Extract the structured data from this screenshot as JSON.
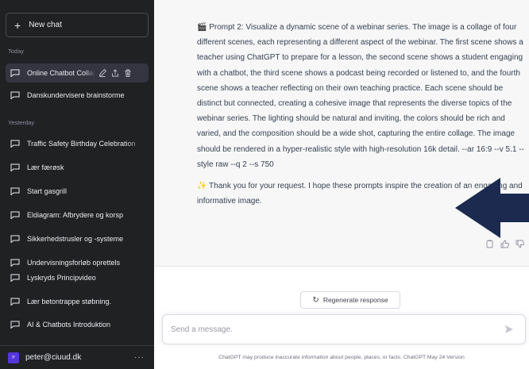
{
  "sidebar": {
    "new_chat_label": "New chat",
    "sections": {
      "today": "Today",
      "yesterday": "Yesterday"
    },
    "today_items": [
      {
        "label": "Online Chatbot Collage"
      },
      {
        "label": "Danskundervisere brainstorme"
      }
    ],
    "yesterday_items": [
      {
        "label": "Traffic Safety Birthday Celebration"
      },
      {
        "label": "Lær færøsk"
      },
      {
        "label": "Start gasgrill"
      },
      {
        "label": "Eldiagram: Afbrydere og korsp"
      },
      {
        "label": "Sikkerhedstrusler og -systeme"
      },
      {
        "label": "Undervisningsforløb oprettels"
      },
      {
        "label": "Lyskryds Principvideo"
      },
      {
        "label": "Lær betontrappe støbning."
      },
      {
        "label": "AI & Chatbots Introduktion"
      }
    ],
    "user": {
      "email": "peter@ciuud.dk",
      "avatar_text": "P",
      "menu": "···"
    }
  },
  "conversation": {
    "prompt_paragraph": "🎬 Prompt 2: Visualize a dynamic scene of a webinar series. The image is a collage of four different scenes, each representing a different aspect of the webinar. The first scene shows a teacher using ChatGPT to prepare for a lesson, the second scene shows a student engaging with a chatbot, the third scene shows a podcast being recorded or listened to, and the fourth scene shows a teacher reflecting on their own teaching practice. Each scene should be distinct but connected, creating a cohesive image that represents the diverse topics of the webinar series. The lighting should be natural and inviting, the colors should be rich and varied, and the composition should be a wide shot, capturing the entire collage. The image should be rendered in a hyper-realistic style with high-resolution 16k detail. --ar 16:9 --v 5.1 --style raw --q 2 --s 750",
    "closing_paragraph": "✨ Thank you for your request. I hope these prompts inspire the creation of an engaging and informative image."
  },
  "composer": {
    "regenerate_label": "Regenerate response",
    "placeholder": "Send a message.",
    "footer_note": "ChatGPT may produce inaccurate information about people, places, or facts. ChatGPT May 24 Version"
  },
  "colors": {
    "sidebar_bg": "#202123",
    "active_item_bg": "#343541",
    "response_bg": "#f7f7f8",
    "arrow_fill": "#1b2a4e"
  }
}
